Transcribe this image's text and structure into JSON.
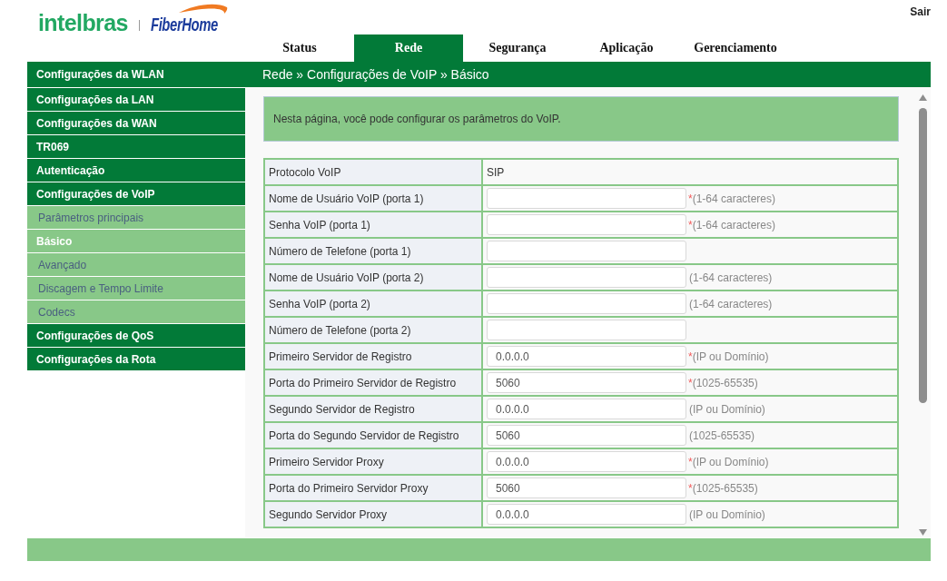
{
  "header": {
    "logo": {
      "brand": "intelbras",
      "partner": "FiberHome"
    },
    "logout": "Sair"
  },
  "tabs": [
    {
      "label": "Status",
      "selected": false
    },
    {
      "label": "Rede",
      "selected": true
    },
    {
      "label": "Segurança",
      "selected": false
    },
    {
      "label": "Aplicação",
      "selected": false
    },
    {
      "label": "Gerenciamento",
      "selected": false
    }
  ],
  "sidebar": {
    "items": [
      {
        "label": "Configurações da WLAN"
      },
      {
        "label": "Configurações da LAN"
      },
      {
        "label": "Configurações da WAN"
      },
      {
        "label": "TR069"
      },
      {
        "label": "Autenticação"
      },
      {
        "label": "Configurações de VoIP",
        "children": [
          {
            "label": "Parâmetros principais",
            "selected": false
          },
          {
            "label": "Básico",
            "selected": true
          },
          {
            "label": "Avançado",
            "selected": false
          },
          {
            "label": "Discagem e Tempo Limite",
            "selected": false
          },
          {
            "label": "Codecs",
            "selected": false
          }
        ]
      },
      {
        "label": "Configurações de QoS"
      },
      {
        "label": "Configurações da Rota"
      }
    ]
  },
  "breadcrumb": "Rede » Configurações de VoIP » Básico",
  "info": "Nesta página, você pode configurar os parâmetros do VoIP.",
  "form": {
    "required_mark": "*",
    "rows": [
      {
        "label": "Protocolo VoIP",
        "kind": "text",
        "value": "SIP"
      },
      {
        "label": "Nome de Usuário VoIP (porta 1)",
        "kind": "input",
        "required": true,
        "hint": "(1-64 caracteres)"
      },
      {
        "label": "Senha VoIP (porta 1)",
        "kind": "input",
        "required": true,
        "hint": "(1-64 caracteres)"
      },
      {
        "label": "Número de Telefone (porta 1)",
        "kind": "input",
        "required": false
      },
      {
        "label": "Nome de Usuário VoIP (porta 2)",
        "kind": "input",
        "required": false,
        "hint": "(1-64 caracteres)"
      },
      {
        "label": "Senha VoIP (porta 2)",
        "kind": "input",
        "required": false,
        "hint": "(1-64 caracteres)"
      },
      {
        "label": "Número de Telefone (porta 2)",
        "kind": "input",
        "required": false
      },
      {
        "label": "Primeiro Servidor de Registro",
        "kind": "input",
        "value": "0.0.0.0",
        "required": true,
        "hint": "(IP ou Domínio)"
      },
      {
        "label": "Porta do Primeiro Servidor de Registro",
        "kind": "input",
        "value": "5060",
        "required": true,
        "hint": "(1025-65535)"
      },
      {
        "label": "Segundo Servidor de Registro",
        "kind": "input",
        "value": "0.0.0.0",
        "required": false,
        "hint": "(IP ou Domínio)"
      },
      {
        "label": "Porta do Segundo Servidor de Registro",
        "kind": "input",
        "value": "5060",
        "required": false,
        "hint": "(1025-65535)"
      },
      {
        "label": "Primeiro Servidor Proxy",
        "kind": "input",
        "value": "0.0.0.0",
        "required": true,
        "hint": "(IP ou Domínio)"
      },
      {
        "label": "Porta do Primeiro Servidor Proxy",
        "kind": "input",
        "value": "5060",
        "required": true,
        "hint": "(1025-65535)"
      },
      {
        "label": "Segundo Servidor Proxy",
        "kind": "input",
        "value": "0.0.0.0",
        "required": false,
        "hint": "(IP ou Domínio)"
      }
    ]
  }
}
